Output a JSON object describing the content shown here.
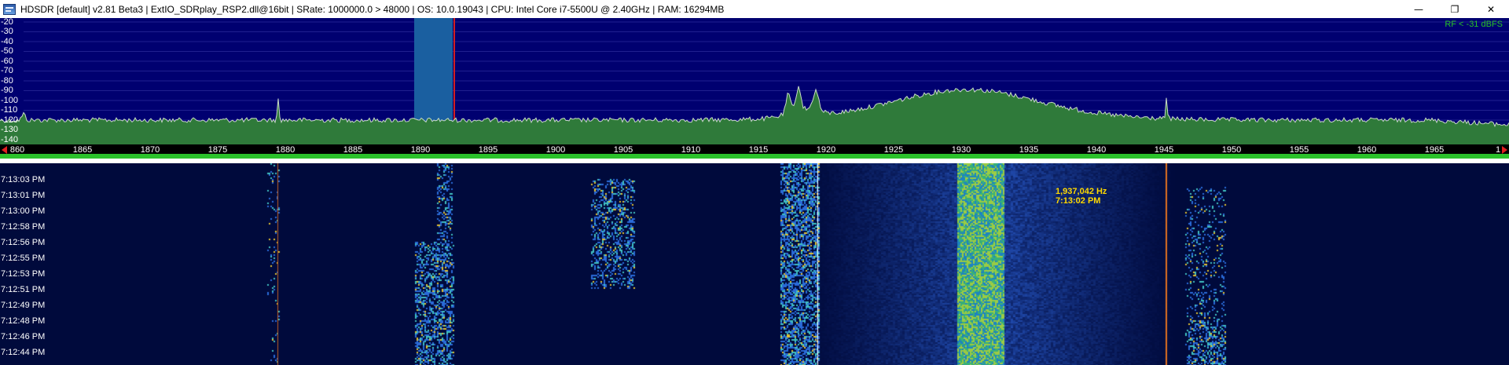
{
  "window": {
    "title": "HDSDR  [default]  v2.81 Beta3  |  ExtIO_SDRplay_RSP2.dll@16bit  |  SRate: 1000000.0 > 48000  |  OS: 10.0.19043  |  CPU: Intel Core i7-5500U @ 2.40GHz  |  RAM: 16294MB",
    "buttons": {
      "minimize": "—",
      "maximize": "❐",
      "close": "✕"
    }
  },
  "spectrum": {
    "rf_level": "RF < -31 dBFS",
    "db_labels": [
      "-20",
      "-30",
      "-40",
      "-50",
      "-60",
      "-70",
      "-80",
      "-90",
      "-100",
      "-110",
      "-120",
      "-130",
      "-140"
    ]
  },
  "freq_scale": {
    "labels": [
      "860",
      "1865",
      "1870",
      "1875",
      "1880",
      "1885",
      "1890",
      "1895",
      "1900",
      "1905",
      "1910",
      "1915",
      "1920",
      "1925",
      "1930",
      "1935",
      "1940",
      "1945",
      "1950",
      "1955",
      "1960",
      "1965",
      "1"
    ]
  },
  "waterfall": {
    "time_labels": [
      "7:13:03 PM",
      "7:13:01 PM",
      "7:13:00 PM",
      "7:12:58 PM",
      "7:12:56 PM",
      "7:12:55 PM",
      "7:12:53 PM",
      "7:12:51 PM",
      "7:12:49 PM",
      "7:12:48 PM",
      "7:12:46 PM",
      "7:12:44 PM"
    ],
    "cursor_frequency": "1,937,042 Hz",
    "cursor_time": "7:13:02 PM"
  },
  "colors": {
    "spectrum_bg": "#000070",
    "spectrum_fill": "#2f7a3a",
    "rf_label": "#27c227",
    "scale_bar": "#2bc22b",
    "filter_band": "#1a5fa0",
    "cursor_text": "#ffd800"
  }
}
